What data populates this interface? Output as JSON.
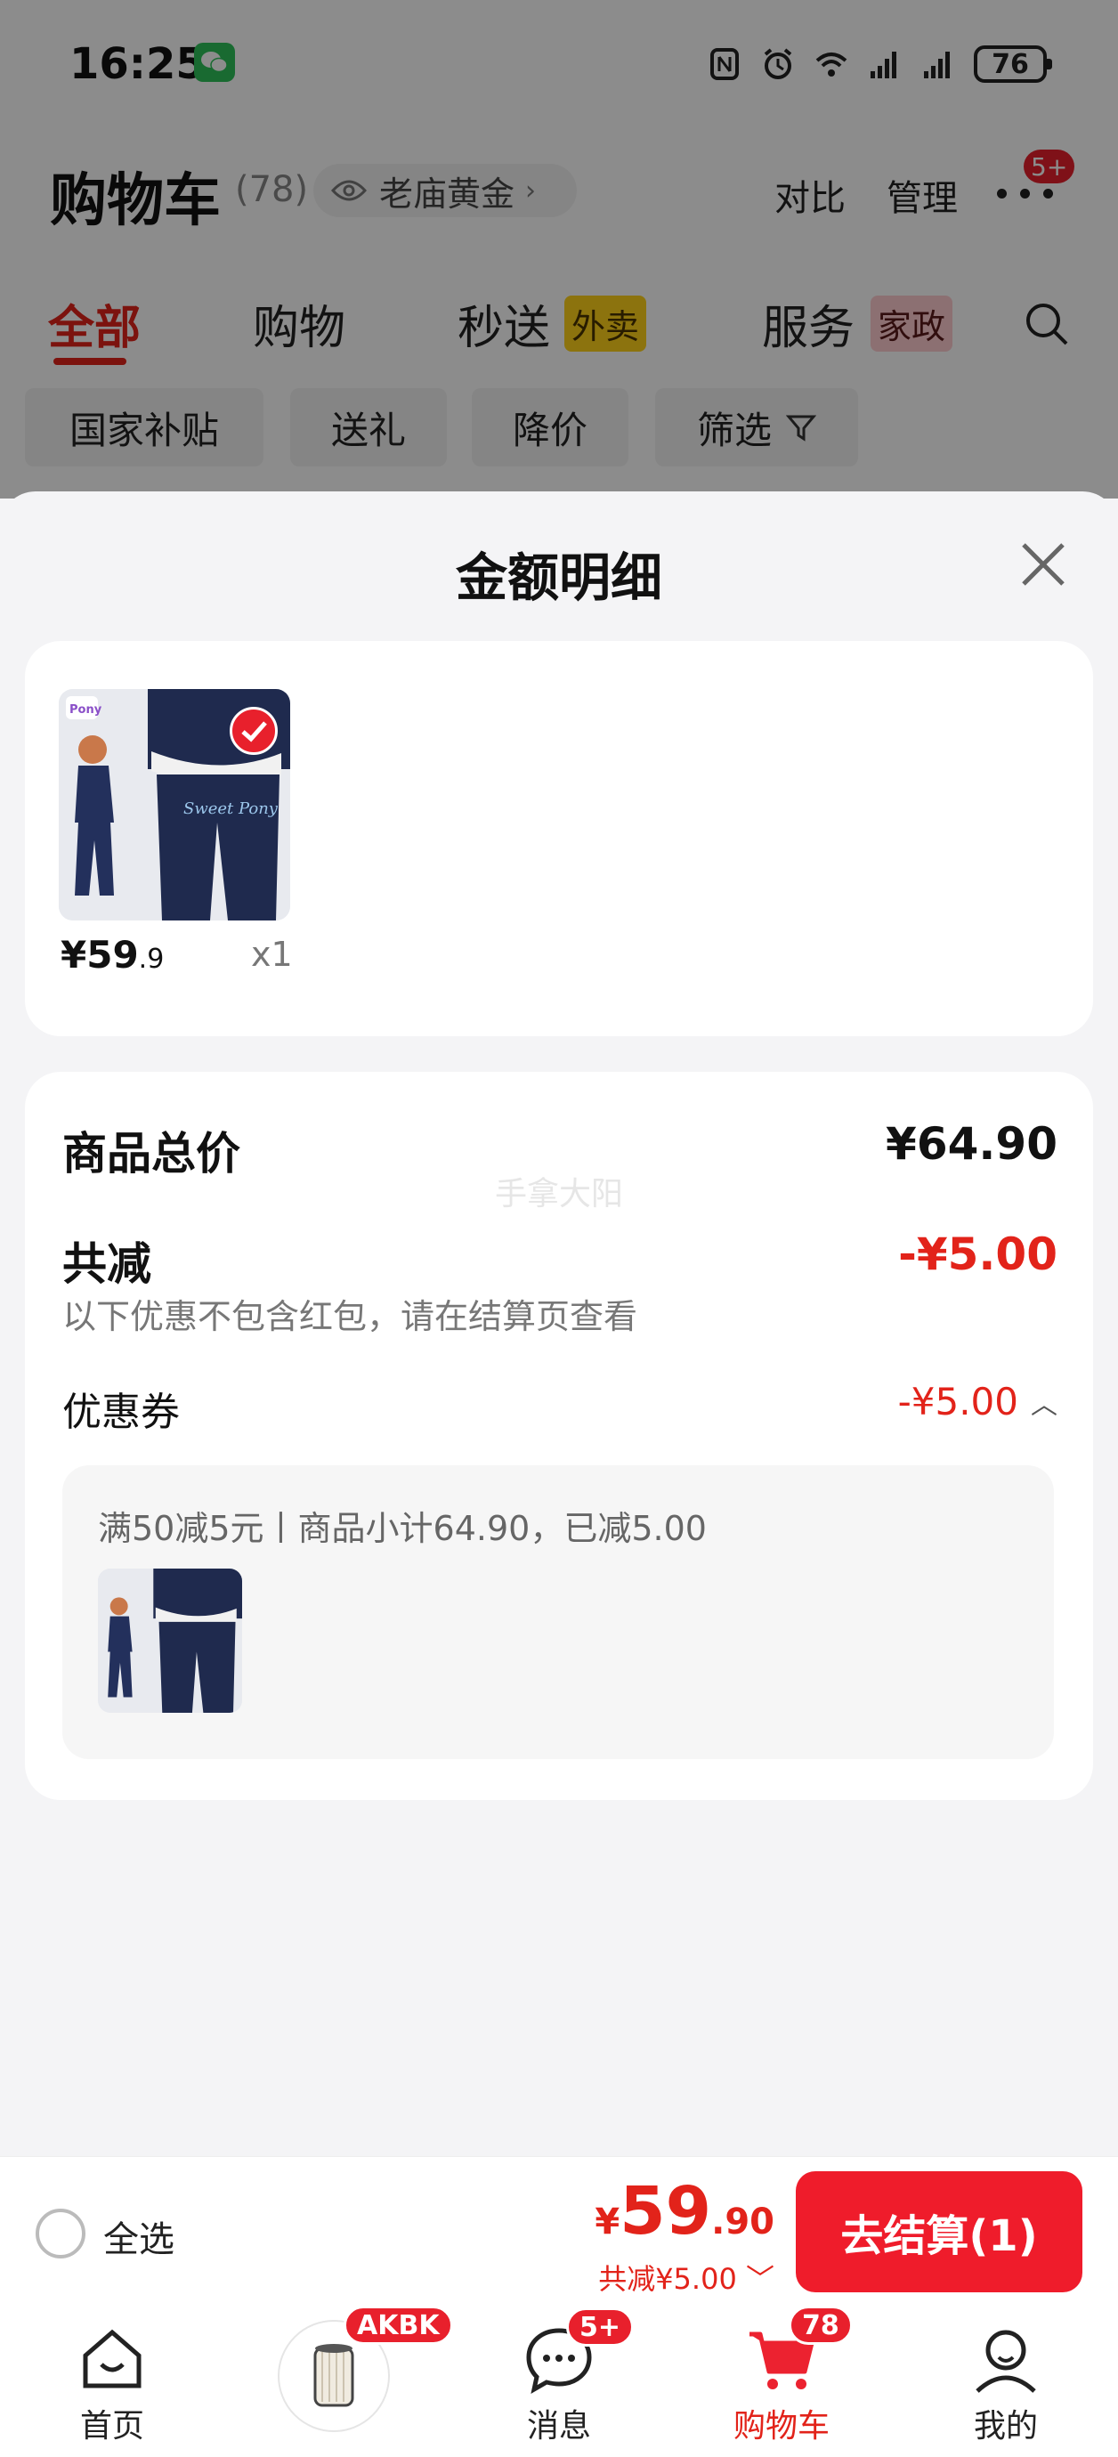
{
  "status_bar": {
    "time": "16:25",
    "battery": "76"
  },
  "cart_header": {
    "title": "购物车",
    "count": "(78)",
    "store_chip": "老庙黄金",
    "compare": "对比",
    "manage": "管理",
    "more_badge": "5+"
  },
  "tabs": [
    {
      "label": "全部",
      "active": true
    },
    {
      "label": "购物"
    },
    {
      "label": "秒送",
      "tag": "外卖"
    },
    {
      "label": "服务",
      "tag": "家政"
    }
  ],
  "filters": [
    "国家补贴",
    "送礼",
    "降价",
    "筛选"
  ],
  "sheet": {
    "title": "金额明细",
    "item": {
      "price_main": "¥59",
      "price_cents": ".9",
      "qty": "x1"
    },
    "total_label": "商品总价",
    "total_value": "¥64.90",
    "watermark": "手拿大阳",
    "discount_label": "共减",
    "discount_value": "-¥5.00",
    "discount_note": "以下优惠不包含红包，请在结算页查看",
    "coupon_label": "优惠券",
    "coupon_value": "-¥5.00",
    "coupon_desc": "满50减5元丨商品小计64.90，已减5.00"
  },
  "checkout": {
    "select_all": "全选",
    "yen": "¥",
    "total_main": "59",
    "total_cents": ".90",
    "discount": "共减¥5.00",
    "button": "去结算(1)"
  },
  "tabbar": {
    "home": "首页",
    "promo_badge": "AKBK",
    "messages": "消息",
    "messages_badge": "5+",
    "cart": "购物车",
    "cart_badge": "78",
    "mine": "我的"
  },
  "colors": {
    "accent": "#e2231a",
    "button": "#ef1c2b",
    "badge": "#e8202c"
  }
}
